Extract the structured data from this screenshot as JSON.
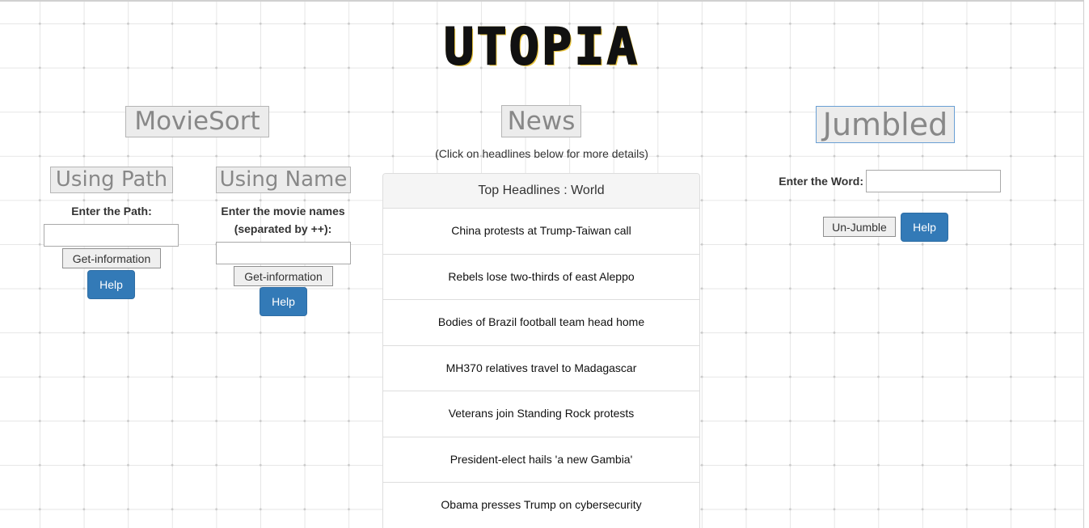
{
  "site": {
    "title": "UTOPIA"
  },
  "moviesort": {
    "heading": "MovieSort",
    "using_path": {
      "heading": "Using Path",
      "label": "Enter the Path:",
      "input_value": "",
      "submit_label": "Get-information",
      "help_label": "Help"
    },
    "using_name": {
      "heading": "Using Name",
      "label_line1": "Enter the movie names",
      "label_line2": "(separated by ++):",
      "input_value": "",
      "submit_label": "Get-information",
      "help_label": "Help"
    }
  },
  "news": {
    "heading": "News",
    "subtitle": "(Click on headlines below for more details)",
    "panel_title": "Top Headlines : World",
    "headlines": [
      "China protests at Trump-Taiwan call",
      "Rebels lose two-thirds of east Aleppo",
      "Bodies of Brazil football team head home",
      "MH370 relatives travel to Madagascar",
      "Veterans join Standing Rock protests",
      "President-elect hails 'a new Gambia'",
      "Obama presses Trump on cybersecurity"
    ]
  },
  "jumbled": {
    "heading": "Jumbled",
    "label": "Enter the Word:",
    "input_value": "",
    "submit_label": "Un-Jumble",
    "help_label": "Help"
  },
  "colors": {
    "primary_button": "#337ab7",
    "heading_text": "#888888",
    "heading_background": "#ececec"
  }
}
